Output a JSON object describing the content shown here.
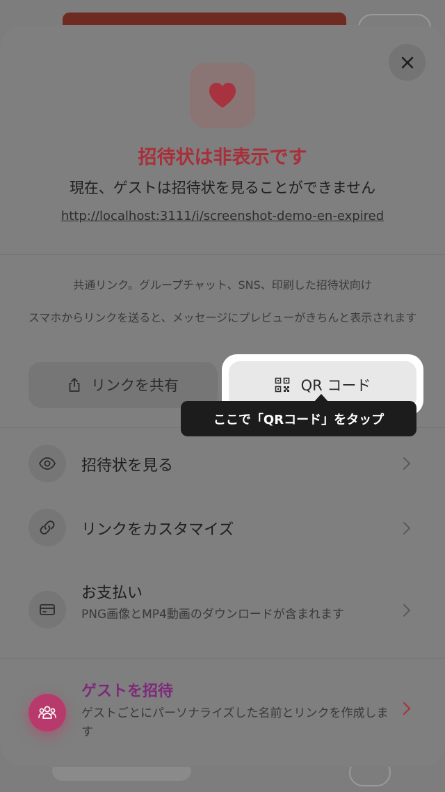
{
  "status": {
    "title": "招待状は非表示です",
    "description": "現在、ゲストは招待状を見ることができません",
    "url": "http://localhost:3111/i/screenshot-demo-en-expired"
  },
  "share_info": {
    "line1": "共通リンク。グループチャット、SNS、印刷した招待状向け",
    "line2": "スマホからリンクを送ると、メッセージにプレビューがきちんと表示されます"
  },
  "buttons": {
    "share_link": "リンクを共有",
    "qr_code": "QR コード"
  },
  "tooltip": "ここで「QRコード」をタップ",
  "rows": [
    {
      "title": "招待状を見る",
      "icon": "eye-icon"
    },
    {
      "title": "リンクをカスタマイズ",
      "icon": "link-icon"
    },
    {
      "title": "お支払い",
      "subtitle": "PNG画像とMP4動画のダウンロードが含まれます",
      "icon": "credit-card-icon"
    }
  ],
  "invite": {
    "title": "ゲストを招待",
    "subtitle": "ゲストごとにパーソナライズした名前とリンクを作成します",
    "icon": "people-icon"
  },
  "colors": {
    "accent_red": "#a82f3a",
    "invite_purple": "#7d2a79",
    "tooltip_bg": "#1c1c1c",
    "highlight": "#ffffff"
  }
}
